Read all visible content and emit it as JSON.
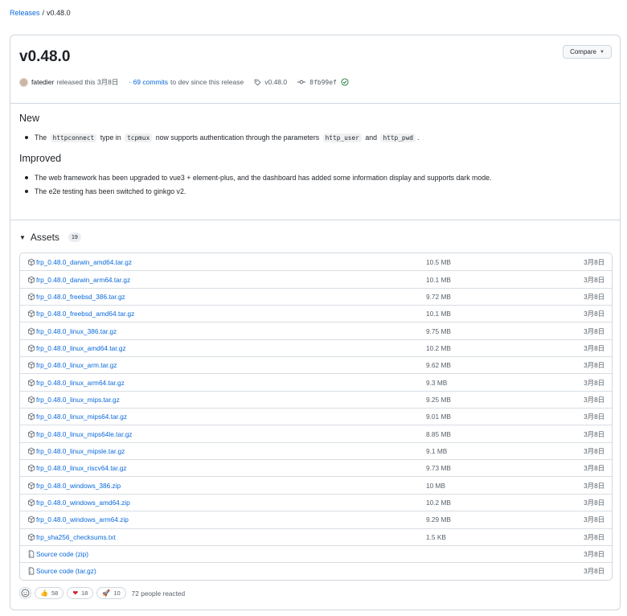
{
  "breadcrumb": {
    "parent": "Releases",
    "separator": "/",
    "current": "v0.48.0"
  },
  "release": {
    "title": "v0.48.0",
    "compare_label": "Compare",
    "author": "fatedier",
    "released_text": "released this 3月8日",
    "commits_link": "· 69 commits",
    "commits_suffix": "to dev since this release",
    "tag": "v0.48.0",
    "commit_sha": "8fb99ef"
  },
  "notes": {
    "new_heading": "New",
    "new_item": {
      "p1": "The",
      "code1": "httpconnect",
      "p2": "type in",
      "code2": "tcpmux",
      "p3": "now supports authentication through the parameters",
      "code3": "http_user",
      "p4": "and",
      "code4": "http_pwd",
      "p5": "."
    },
    "improved_heading": "Improved",
    "improved_items": [
      "The web framework has been upgraded to vue3 + element-plus, and the dashboard has added some information display and supports dark mode.",
      "The e2e testing has been switched to ginkgo v2."
    ]
  },
  "assets": {
    "label": "Assets",
    "count": "19",
    "items": [
      {
        "name": "frp_0.48.0_darwin_amd64.tar.gz",
        "size": "10.5 MB",
        "date": "3月8日",
        "icon": "package-icon"
      },
      {
        "name": "frp_0.48.0_darwin_arm64.tar.gz",
        "size": "10.1 MB",
        "date": "3月8日",
        "icon": "package-icon"
      },
      {
        "name": "frp_0.48.0_freebsd_386.tar.gz",
        "size": "9.72 MB",
        "date": "3月8日",
        "icon": "package-icon"
      },
      {
        "name": "frp_0.48.0_freebsd_amd64.tar.gz",
        "size": "10.1 MB",
        "date": "3月8日",
        "icon": "package-icon"
      },
      {
        "name": "frp_0.48.0_linux_386.tar.gz",
        "size": "9.75 MB",
        "date": "3月8日",
        "icon": "package-icon"
      },
      {
        "name": "frp_0.48.0_linux_amd64.tar.gz",
        "size": "10.2 MB",
        "date": "3月8日",
        "icon": "package-icon"
      },
      {
        "name": "frp_0.48.0_linux_arm.tar.gz",
        "size": "9.62 MB",
        "date": "3月8日",
        "icon": "package-icon"
      },
      {
        "name": "frp_0.48.0_linux_arm64.tar.gz",
        "size": "9.3 MB",
        "date": "3月8日",
        "icon": "package-icon"
      },
      {
        "name": "frp_0.48.0_linux_mips.tar.gz",
        "size": "9.25 MB",
        "date": "3月8日",
        "icon": "package-icon"
      },
      {
        "name": "frp_0.48.0_linux_mips64.tar.gz",
        "size": "9.01 MB",
        "date": "3月8日",
        "icon": "package-icon"
      },
      {
        "name": "frp_0.48.0_linux_mips64le.tar.gz",
        "size": "8.85 MB",
        "date": "3月8日",
        "icon": "package-icon"
      },
      {
        "name": "frp_0.48.0_linux_mipsle.tar.gz",
        "size": "9.1 MB",
        "date": "3月8日",
        "icon": "package-icon"
      },
      {
        "name": "frp_0.48.0_linux_riscv64.tar.gz",
        "size": "9.73 MB",
        "date": "3月8日",
        "icon": "package-icon"
      },
      {
        "name": "frp_0.48.0_windows_386.zip",
        "size": "10 MB",
        "date": "3月8日",
        "icon": "package-icon"
      },
      {
        "name": "frp_0.48.0_windows_amd64.zip",
        "size": "10.2 MB",
        "date": "3月8日",
        "icon": "package-icon"
      },
      {
        "name": "frp_0.48.0_windows_arm64.zip",
        "size": "9.29 MB",
        "date": "3月8日",
        "icon": "package-icon"
      },
      {
        "name": "frp_sha256_checksums.txt",
        "size": "1.5 KB",
        "date": "3月8日",
        "icon": "package-icon"
      },
      {
        "name": "Source code (zip)",
        "size": "",
        "date": "3月8日",
        "icon": "file-zip-icon"
      },
      {
        "name": "Source code (tar.gz)",
        "size": "",
        "date": "3月8日",
        "icon": "file-zip-icon"
      }
    ]
  },
  "reactions": {
    "thumbs_up_emoji": "👍",
    "thumbs_up": "58",
    "heart_emoji": "❤",
    "heart": "18",
    "rocket_emoji": "🚀",
    "rocket": "10",
    "summary": "72 people reacted"
  },
  "colors": {
    "link": "#0969da",
    "border": "#d0d7de",
    "success": "#1a7f37"
  }
}
